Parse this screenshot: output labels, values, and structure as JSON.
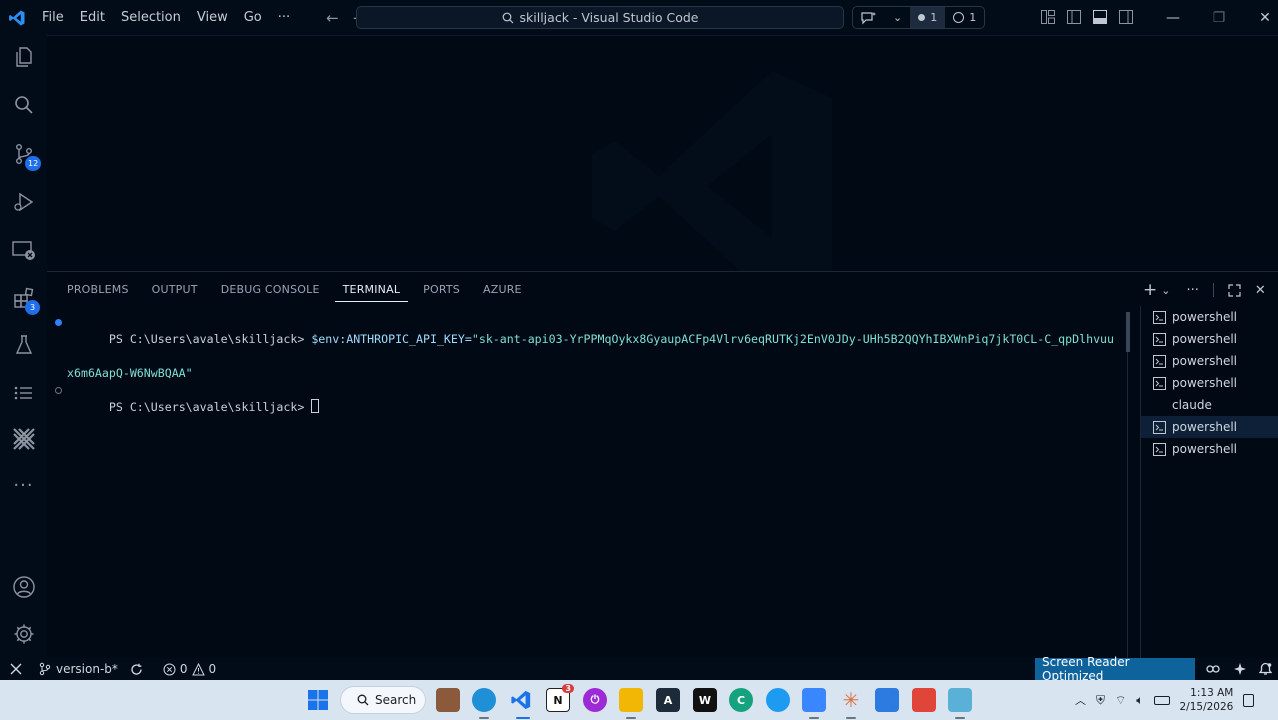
{
  "app": {
    "title": "skilljack - Visual Studio Code",
    "menu": [
      "File",
      "Edit",
      "Selection",
      "View",
      "Go",
      "···"
    ],
    "title_controls": {
      "dot_count": "1",
      "circle_count": "1"
    },
    "accent": "#1f6feb"
  },
  "activity_bar": {
    "items": [
      {
        "name": "explorer-icon"
      },
      {
        "name": "search-icon"
      },
      {
        "name": "source-control-icon",
        "badge": "12"
      },
      {
        "name": "run-debug-icon"
      },
      {
        "name": "remote-explorer-icon"
      },
      {
        "name": "extensions-icon",
        "badge": "3"
      },
      {
        "name": "testing-icon"
      },
      {
        "name": "outline-icon"
      },
      {
        "name": "tools-icon"
      },
      {
        "name": "more-icon"
      }
    ],
    "bottom": [
      {
        "name": "account-icon"
      },
      {
        "name": "settings-gear-icon"
      }
    ]
  },
  "panel": {
    "tabs": [
      "PROBLEMS",
      "OUTPUT",
      "DEBUG CONSOLE",
      "TERMINAL",
      "PORTS",
      "AZURE"
    ],
    "active_tab": "TERMINAL",
    "terminal": {
      "line1_prompt": "PS C:\\Users\\avale\\skilljack> ",
      "line1_cmd": "$env:ANTHROPIC_API_KEY=",
      "line1_value_a": "\"sk-ant-api03-YrPPMqOykx8GyaupACFp4Vlrv6eqRUTKj2EnV0JDy-UHh5B2QQYhIBXWnPiq7jkT0CL-C_qpDlhvuu",
      "line1_value_b": "x6m6AapQ-W6NwBQAA\"",
      "line2_prompt": "PS C:\\Users\\avale\\skilljack> "
    },
    "terminals": [
      {
        "label": "powershell"
      },
      {
        "label": "powershell"
      },
      {
        "label": "powershell"
      },
      {
        "label": "powershell"
      },
      {
        "label": "claude"
      },
      {
        "label": "powershell",
        "selected": true
      },
      {
        "label": "powershell"
      }
    ]
  },
  "status_bar": {
    "branch": "version-b*",
    "errors": "0",
    "warnings": "0",
    "screen_reader": "Screen Reader Optimized"
  },
  "taskbar": {
    "search_label": "Search",
    "notion_badge": "3",
    "time": "1:13 AM",
    "date": "2/15/2026"
  }
}
